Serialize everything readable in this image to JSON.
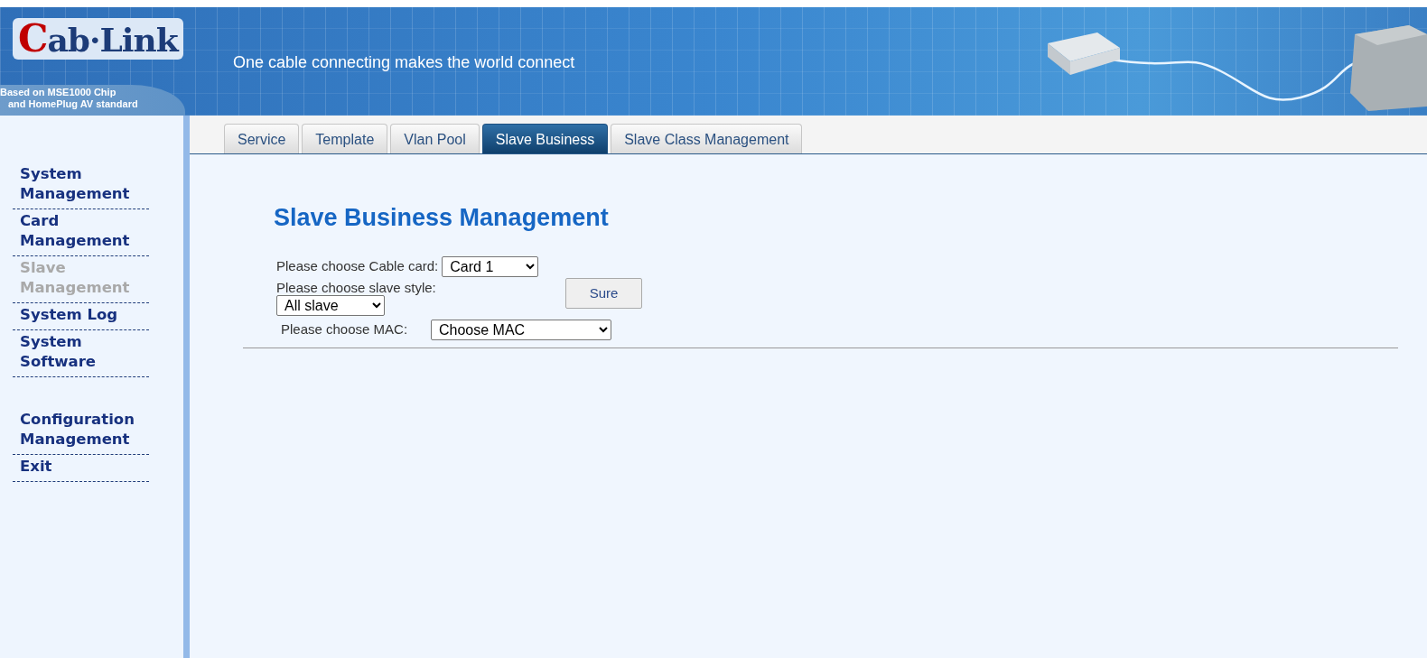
{
  "banner": {
    "logo": "Cab·Link",
    "slogan": "One cable connecting makes the world connect",
    "subtitle_lines": [
      "Based on MSE1000 Chip",
      "and HomePlug AV standard"
    ]
  },
  "sidebar": {
    "groups": [
      [
        {
          "label": "System Management",
          "selected": false
        },
        {
          "label": "Card Management",
          "selected": false
        },
        {
          "label": "Slave Management",
          "selected": true
        },
        {
          "label": "System Log",
          "selected": false
        },
        {
          "label": "System Software",
          "selected": false
        }
      ],
      [
        {
          "label": "Configuration Management",
          "selected": false
        },
        {
          "label": "Exit",
          "selected": false
        }
      ]
    ]
  },
  "tabs": [
    {
      "label": "Service",
      "selected": false
    },
    {
      "label": "Template",
      "selected": false
    },
    {
      "label": "Vlan Pool",
      "selected": false
    },
    {
      "label": "Slave Business",
      "selected": true
    },
    {
      "label": "Slave Class Management",
      "selected": false
    }
  ],
  "page_title": "Slave Business Management",
  "form": {
    "card_label": "Please choose Cable card:",
    "card_value": "Card 1",
    "style_label": "Please choose slave style:",
    "style_value": "All slave",
    "mac_label": "Please choose MAC:",
    "mac_value": "Choose MAC",
    "submit": "Sure"
  }
}
